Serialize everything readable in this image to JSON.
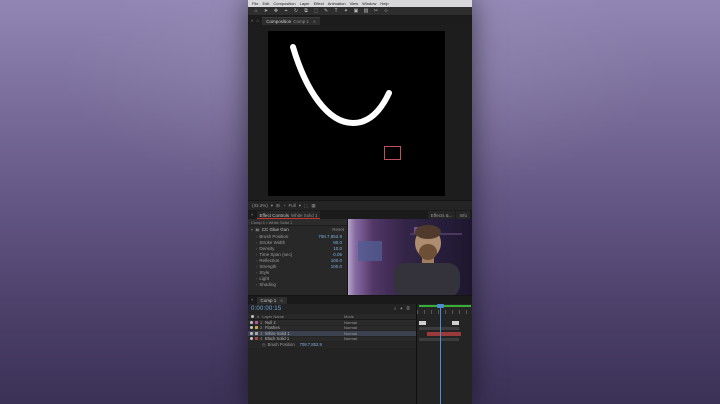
{
  "colors": {
    "accent_blue": "#7fb0dc",
    "timecode_blue": "#6ea7e0",
    "selection_red": "#c14f5e",
    "ram_green": "#35b034"
  },
  "menu": {
    "items": [
      "File",
      "Edit",
      "Composition",
      "Layer",
      "Effect",
      "Animation",
      "View",
      "Window",
      "Help"
    ]
  },
  "toolbar": {
    "tools": [
      {
        "name": "home-icon",
        "glyph": "⌂"
      },
      {
        "name": "selection-tool-icon",
        "glyph": "➤"
      },
      {
        "name": "hand-tool-icon",
        "glyph": "✥"
      },
      {
        "name": "zoom-tool-icon",
        "glyph": "⌖"
      },
      {
        "name": "orbit-camera-tool-icon",
        "glyph": "↻"
      },
      {
        "name": "pan-behind-tool-icon",
        "glyph": "⧉"
      },
      {
        "name": "mask-shape-tool-icon",
        "glyph": "⬚"
      },
      {
        "name": "pen-tool-icon",
        "glyph": "✎"
      },
      {
        "name": "type-tool-icon",
        "glyph": "T"
      },
      {
        "name": "brush-tool-icon",
        "glyph": "✦"
      },
      {
        "name": "clone-stamp-tool-icon",
        "glyph": "▣"
      },
      {
        "name": "eraser-tool-icon",
        "glyph": "▨"
      },
      {
        "name": "roto-brush-tool-icon",
        "glyph": "✂"
      },
      {
        "name": "puppet-pin-tool-icon",
        "glyph": "⊹"
      }
    ]
  },
  "chrome_glyphs": {
    "chevrons": "«",
    "home": "⌂",
    "menu": "≡",
    "caret": "▾",
    "twirl": "›",
    "down": "▾",
    "stopwatch": "◷"
  },
  "comp_tab": {
    "panel": "Composition",
    "comp": "Comp 1"
  },
  "viewer": {
    "zoom": "(33.3%)",
    "resolution": "Full",
    "icon_glyphs": {
      "grid": "⊞",
      "channels": "◔",
      "roi": "⬚",
      "transparency": "▦"
    }
  },
  "effect_controls": {
    "tab": "Effect Controls",
    "target": "White Solid 1",
    "right_tabs": [
      "Effects &...",
      "Info"
    ],
    "breadcrumb": "Comp 1 • White Solid 1",
    "fx_badge": "fx",
    "effect_name": "CC Glue Gun",
    "reset_label": "Reset",
    "properties": [
      {
        "name": "Brush Position",
        "value": "708.7,852.9"
      },
      {
        "name": "Stroke Width",
        "value": "80.0"
      },
      {
        "name": "Density",
        "value": "10.0"
      },
      {
        "name": "Time Span (sec)",
        "value": "0.05"
      },
      {
        "name": "Reflection",
        "value": "100.0"
      },
      {
        "name": "Strength",
        "value": "100.0"
      },
      {
        "name": "Style",
        "value": ""
      },
      {
        "name": "Light",
        "value": ""
      },
      {
        "name": "Shading",
        "value": ""
      }
    ]
  },
  "timeline": {
    "tab": "Comp 1",
    "timecode": "0:00:00:15",
    "head_icons": [
      {
        "name": "search-icon",
        "glyph": "⌕"
      },
      {
        "name": "motion-blur-icon",
        "glyph": "✦"
      },
      {
        "name": "graph-editor-icon",
        "glyph": "≣"
      }
    ],
    "columns": {
      "hash": "#",
      "layer_name": "Layer Name",
      "mode": "Mode"
    },
    "layers": [
      {
        "num": "1",
        "name": "Null 2",
        "mode": "Normal",
        "color": "#b0599a"
      },
      {
        "num": "2",
        "name": "Flashes",
        "mode": "Normal",
        "color": "#c7a84c"
      },
      {
        "num": "3",
        "name": "White Solid 1",
        "mode": "Normal",
        "color": "#aaaaaa",
        "selected": true
      },
      {
        "num": "4",
        "name": "Black Solid 1",
        "mode": "Normal",
        "color": "#aa4747"
      }
    ],
    "property_row": {
      "name": "Brush Position",
      "value": "708.7,852.9"
    }
  }
}
